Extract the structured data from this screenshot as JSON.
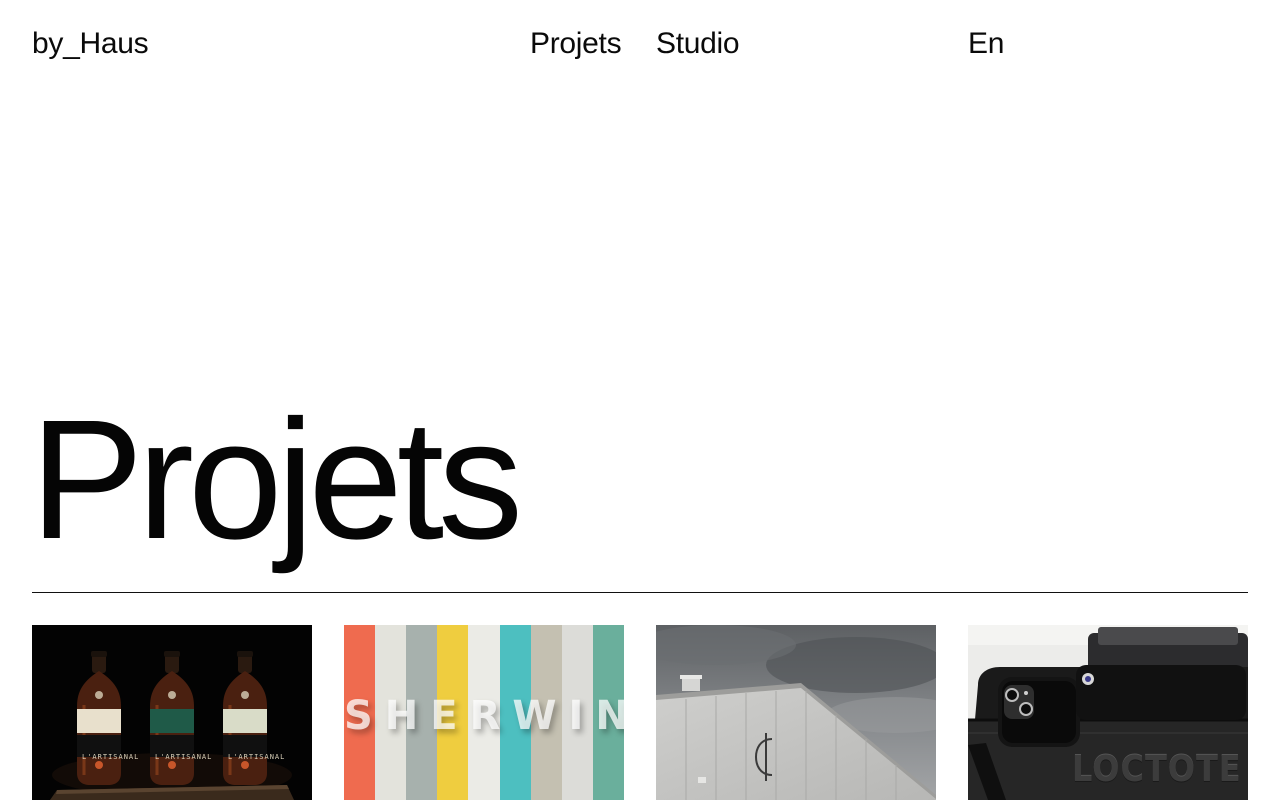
{
  "header": {
    "logo": "by_Haus",
    "nav": {
      "projects": "Projets",
      "studio": "Studio",
      "language": "En"
    }
  },
  "main": {
    "title": "Projets"
  },
  "projects": [
    {
      "image_description": "three whisky bottles on black background",
      "label_text": "L'ARTISANAL"
    },
    {
      "image_description": "colored vertical stripes",
      "word": "SHERWIN",
      "stripe_colors": [
        "#ef6b4f",
        "#e3e3dc",
        "#a7b1ad",
        "#efcd3f",
        "#ebebe6",
        "#4dbfc0",
        "#c4c0b1",
        "#dcdcd8",
        "#6aaf9c"
      ]
    },
    {
      "image_description": "building facade under cloudy sky"
    },
    {
      "image_description": "black bag with phone",
      "word": "LOCTOTE"
    }
  ],
  "colors": {
    "text": "#0a0a0a",
    "background": "#ffffff",
    "divider": "#111111"
  }
}
